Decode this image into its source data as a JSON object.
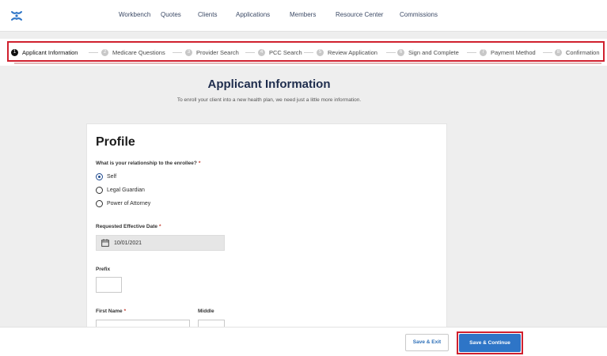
{
  "nav": {
    "links": [
      "Workbench",
      "Quotes",
      "Clients",
      "Applications",
      "Members",
      "Resource Center",
      "Commissions"
    ]
  },
  "steps": [
    {
      "num": "1",
      "label": "Applicant Information",
      "active": true
    },
    {
      "num": "2",
      "label": "Medicare Questions"
    },
    {
      "num": "3",
      "label": "Provider Search"
    },
    {
      "num": "4",
      "label": "PCC Search"
    },
    {
      "num": "5",
      "label": "Review Application"
    },
    {
      "num": "6",
      "label": "Sign and Complete"
    },
    {
      "num": "7",
      "label": "Payment Method"
    },
    {
      "num": "8",
      "label": "Confirmation"
    }
  ],
  "page": {
    "title": "Applicant Information",
    "subtitle": "To enroll your client into a new health plan, we need just a little more information."
  },
  "profile": {
    "heading": "Profile",
    "relationship_question": "What is your relationship to the enrollee?",
    "required_mark": "*",
    "options": [
      {
        "label": "Self",
        "selected": true
      },
      {
        "label": "Legal Guardian"
      },
      {
        "label": "Power of Attorney"
      }
    ],
    "effective_date_label": "Requested Effective Date",
    "effective_date_value": "10/01/2021",
    "prefix_label": "Prefix",
    "first_name_label": "First Name",
    "middle_label": "Middle"
  },
  "footer": {
    "save_exit": "Save & Exit",
    "save_continue": "Save & Continue"
  },
  "colors": {
    "brand": "#2e75c7",
    "highlight": "#d0202e",
    "title": "#1f2d4d"
  },
  "icons": {
    "logo": "brand-logo-icon",
    "calendar": "calendar-icon"
  }
}
